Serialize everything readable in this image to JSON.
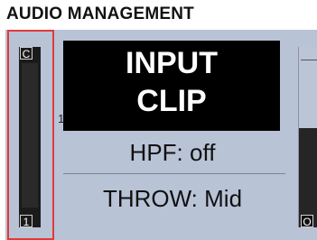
{
  "header": {
    "title": "AUDIO MANAGEMENT"
  },
  "left_meter": {
    "top_label": "C",
    "bottom_label": "1"
  },
  "alert": {
    "line1": "INPUT",
    "line2": "CLIP"
  },
  "partial_label": "1",
  "settings": [
    {
      "label": "HPF: off"
    },
    {
      "label": "THROW: Mid"
    }
  ],
  "right_meter": {
    "bottom_label": "O",
    "level_fraction": 0.55
  },
  "colors": {
    "screen_bg": "#b9c3d6",
    "selection_outline": "#e23a3a",
    "alert_bg": "#000000",
    "meter_bg": "#1b1b1b"
  }
}
